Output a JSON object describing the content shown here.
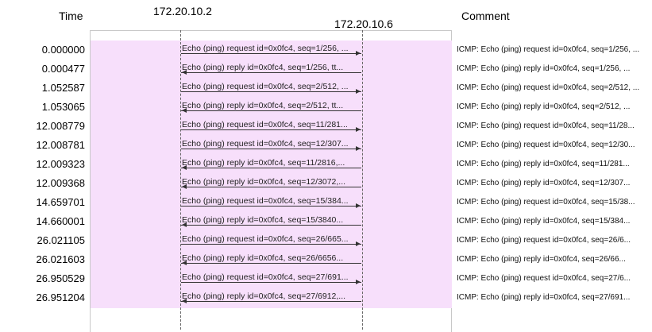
{
  "headers": {
    "time": "Time",
    "host_a": "172.20.10.2",
    "host_b": "172.20.10.6",
    "comment": "Comment"
  },
  "rows": [
    {
      "time": "0.000000",
      "label": "Echo (ping) request  id=0x0fc4, seq=1/256, ...",
      "direction": "right",
      "comment": "ICMP: Echo (ping) request  id=0x0fc4, seq=1/256, ..."
    },
    {
      "time": "0.000477",
      "label": "Echo (ping) reply    id=0x0fc4, seq=1/256, tt...",
      "direction": "left",
      "comment": "ICMP: Echo (ping) reply    id=0x0fc4, seq=1/256, ..."
    },
    {
      "time": "1.052587",
      "label": "Echo (ping) request  id=0x0fc4, seq=2/512, ...",
      "direction": "right",
      "comment": "ICMP: Echo (ping) request  id=0x0fc4, seq=2/512, ..."
    },
    {
      "time": "1.053065",
      "label": "Echo (ping) reply    id=0x0fc4, seq=2/512, tt...",
      "direction": "left",
      "comment": "ICMP: Echo (ping) reply    id=0x0fc4, seq=2/512, ..."
    },
    {
      "time": "12.008779",
      "label": "Echo (ping) request  id=0x0fc4, seq=11/281...",
      "direction": "right",
      "comment": "ICMP: Echo (ping) request  id=0x0fc4, seq=11/28..."
    },
    {
      "time": "12.008781",
      "label": "Echo (ping) request  id=0x0fc4, seq=12/307...",
      "direction": "right",
      "comment": "ICMP: Echo (ping) request  id=0x0fc4, seq=12/30..."
    },
    {
      "time": "12.009323",
      "label": "Echo (ping) reply    id=0x0fc4, seq=11/2816,...",
      "direction": "left",
      "comment": "ICMP: Echo (ping) reply    id=0x0fc4, seq=11/281..."
    },
    {
      "time": "12.009368",
      "label": "Echo (ping) reply    id=0x0fc4, seq=12/3072,...",
      "direction": "left",
      "comment": "ICMP: Echo (ping) reply    id=0x0fc4, seq=12/307..."
    },
    {
      "time": "14.659701",
      "label": "Echo (ping) request  id=0x0fc4, seq=15/384...",
      "direction": "right",
      "comment": "ICMP: Echo (ping) request  id=0x0fc4, seq=15/38..."
    },
    {
      "time": "14.660001",
      "label": "Echo (ping) reply    id=0x0fc4, seq=15/3840...",
      "direction": "left",
      "comment": "ICMP: Echo (ping) reply    id=0x0fc4, seq=15/384..."
    },
    {
      "time": "26.021105",
      "label": "Echo (ping) request  id=0x0fc4, seq=26/665...",
      "direction": "right",
      "comment": "ICMP: Echo (ping) request  id=0x0fc4, seq=26/6..."
    },
    {
      "time": "26.021603",
      "label": "Echo (ping) reply    id=0x0fc4, seq=26/6656...",
      "direction": "left",
      "comment": "ICMP: Echo (ping) reply    id=0x0fc4, seq=26/66..."
    },
    {
      "time": "26.950529",
      "label": "Echo (ping) request  id=0x0fc4, seq=27/691...",
      "direction": "right",
      "comment": "ICMP: Echo (ping) request  id=0x0fc4, seq=27/6..."
    },
    {
      "time": "26.951204",
      "label": "Echo (ping) reply    id=0x0fc4, seq=27/6912,...",
      "direction": "left",
      "comment": "ICMP: Echo (ping) reply    id=0x0fc4, seq=27/691..."
    }
  ]
}
